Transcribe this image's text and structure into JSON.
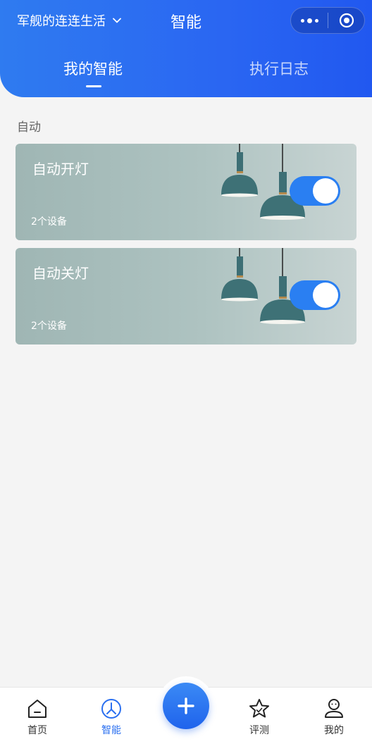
{
  "header": {
    "home_name": "军舰的连连生活",
    "title": "智能",
    "capsule": {
      "more_icon": "more-dots-icon",
      "close_icon": "target-circle-icon"
    }
  },
  "tabs": [
    {
      "label": "我的智能",
      "active": true
    },
    {
      "label": "执行日志",
      "active": false
    }
  ],
  "section": {
    "label": "自动"
  },
  "automations": [
    {
      "title": "自动开灯",
      "device_count": "2个设备",
      "enabled": true
    },
    {
      "title": "自动关灯",
      "device_count": "2个设备",
      "enabled": true
    }
  ],
  "tabbar": {
    "items": [
      {
        "label": "首页",
        "icon": "home-icon",
        "active": false
      },
      {
        "label": "智能",
        "icon": "smart-icon",
        "active": true
      },
      {
        "label": "评测",
        "icon": "star-icon",
        "active": false
      },
      {
        "label": "我的",
        "icon": "profile-icon",
        "active": false
      }
    ],
    "add_icon": "plus-icon"
  },
  "colors": {
    "accent": "#2a6ff0",
    "header_start": "#2f7bf0",
    "header_end": "#2158f0",
    "card_bg": "#aec3c1"
  }
}
